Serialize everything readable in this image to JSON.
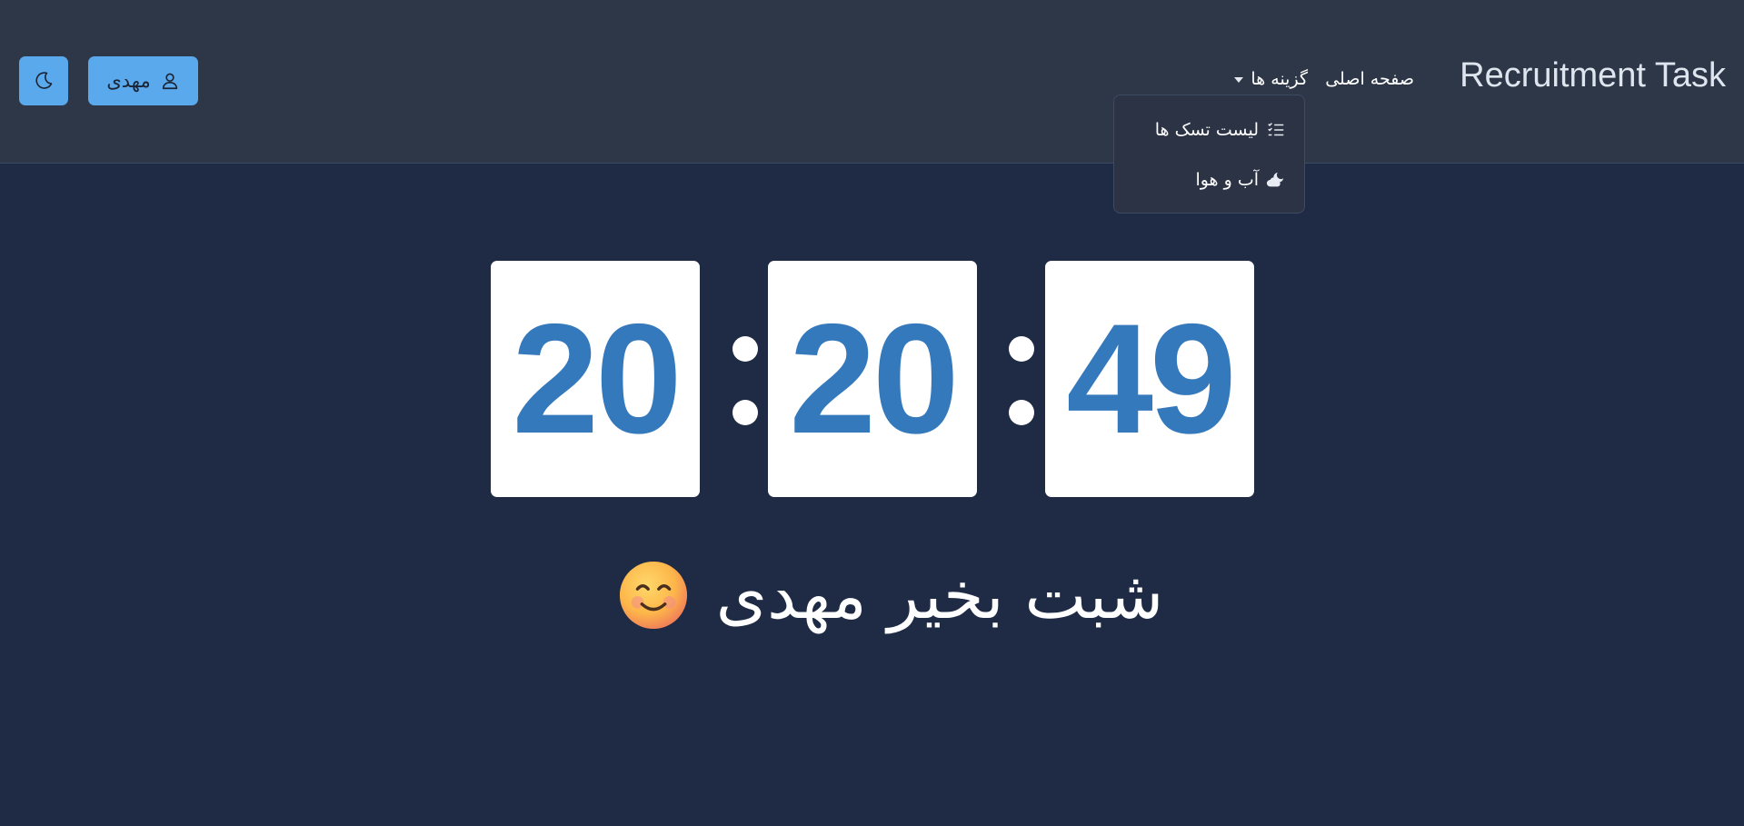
{
  "navbar": {
    "brand": "Recruitment Task",
    "home_link": "صفحه اصلی",
    "options_menu": "گزینه ها",
    "dropdown": [
      {
        "label": "لیست تسک ها",
        "icon": "task-list-icon"
      },
      {
        "label": "آب و هوا",
        "icon": "weather-icon"
      }
    ],
    "user_button": {
      "label": "مهدی",
      "icon": "user-icon"
    },
    "theme_button": {
      "icon": "moon-icon"
    }
  },
  "clock": {
    "hours": "20",
    "minutes": "20",
    "seconds": "49",
    "digit_color": "#3579bd"
  },
  "greeting": {
    "text": "شبت بخیر مهدی",
    "emoji": "smiling-face-icon"
  },
  "colors": {
    "background": "#1f2a44",
    "navbar": "#2e3748",
    "button": "#5aa9ec"
  }
}
